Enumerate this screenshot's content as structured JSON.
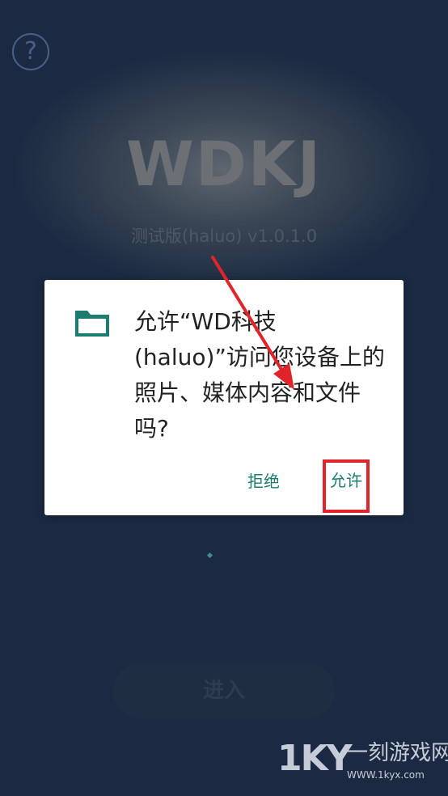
{
  "background": {
    "help_symbol": "?",
    "logo_text": "WDKJ",
    "version_text": "测试版(haluo)  v1.0.1.0",
    "enter_button_label": "进入"
  },
  "permission_dialog": {
    "icon": "folder-icon",
    "message": "允许“WD科技(haluo)”访问您设备上的照片、媒体内容和文件吗?",
    "deny_label": "拒绝",
    "allow_label": "允许"
  },
  "annotation": {
    "arrow_color": "#e0242a",
    "highlight_color": "#e0242a"
  },
  "watermark": {
    "logo": "1KY",
    "name": "一刻游戏网",
    "url": "WWW.1kyx.com"
  },
  "colors": {
    "accent": "#1a7d70",
    "background": "#1b2a42"
  }
}
